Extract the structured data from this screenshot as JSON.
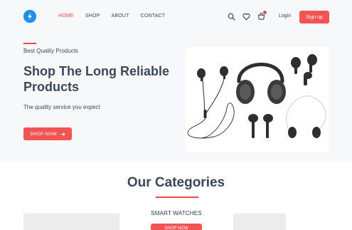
{
  "nav": {
    "links": [
      {
        "label": "HOME",
        "active": true
      },
      {
        "label": "SHOP",
        "active": false
      },
      {
        "label": "ABOUT",
        "active": false
      },
      {
        "label": "CONTACT",
        "active": false
      }
    ],
    "icons": [
      "search-icon",
      "heart-icon",
      "cart-icon"
    ],
    "login_label": "Login",
    "signup_label": "Sign up"
  },
  "hero": {
    "eyebrow": "Best Quality Products",
    "headline": "Shop The Long Reliable Products",
    "subtext": "The quality service you expect",
    "cta_label": "SHOP NOW",
    "cta_icon": "arrow-right-icon"
  },
  "categories": {
    "title": "Our Categories",
    "featured_label": "SMART WATCHES",
    "featured_button": "SHOP NOW"
  },
  "colors": {
    "accent": "#f25454",
    "text": "#3c4858",
    "hero_bg": "#f7f8fa"
  }
}
